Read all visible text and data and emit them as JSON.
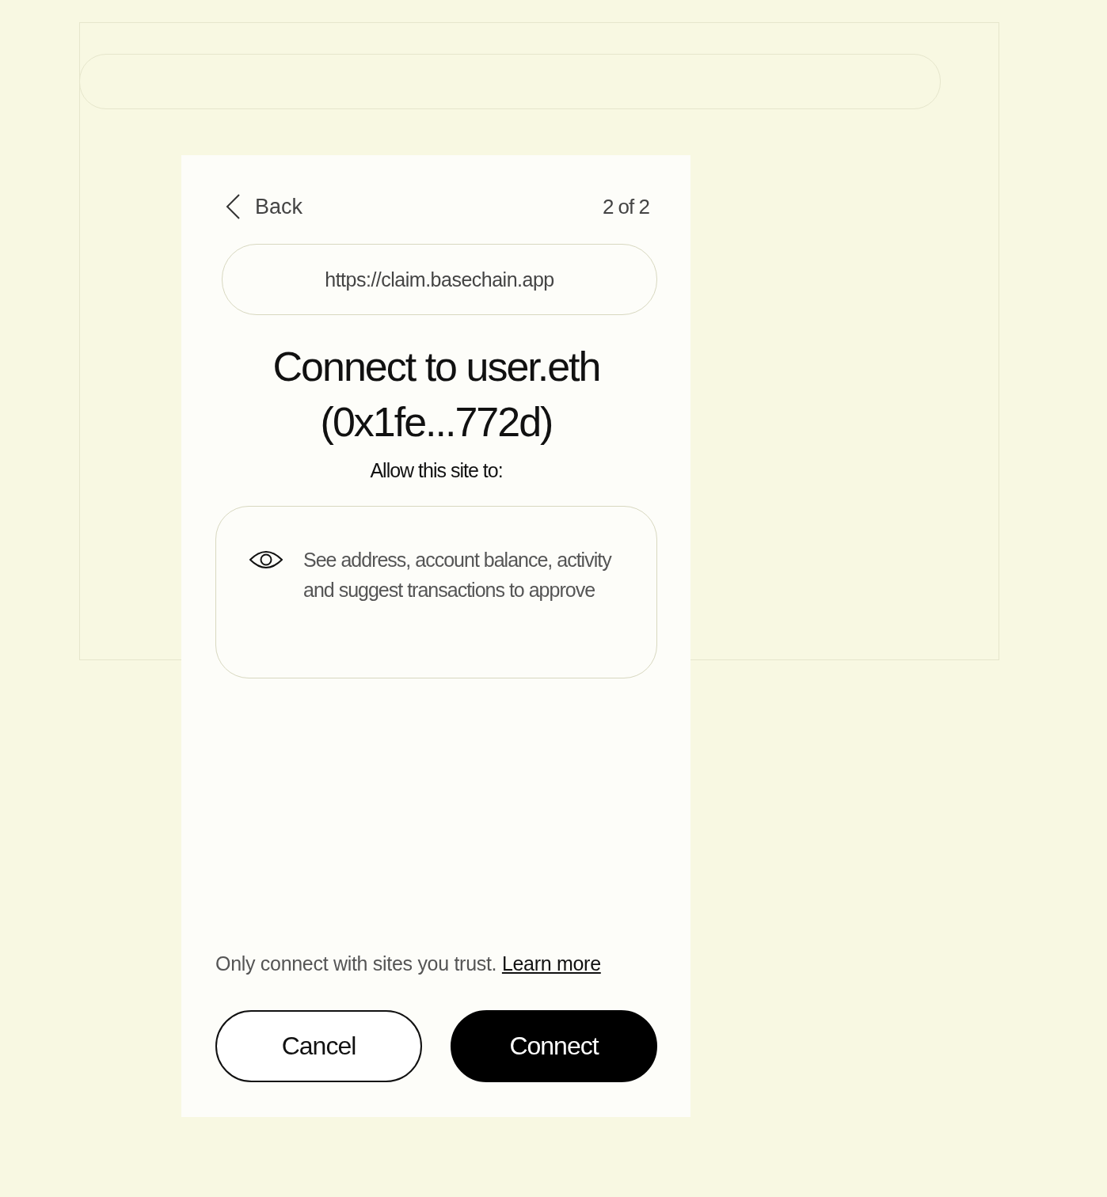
{
  "dialog": {
    "back_label": "Back",
    "step": "2 of 2",
    "site_url": "https://claim.basechain.app",
    "title": "Connect to user.eth (0x1fe...772d)",
    "subtitle": "Allow this site to:",
    "permissions": [
      {
        "kind": "view",
        "text": "See address, account balance, activity and suggest transactions to approve"
      }
    ],
    "notice": "Only connect with sites you trust.",
    "notice_link": "Learn more",
    "buttons": [
      {
        "kind": "secondary",
        "label": "Cancel"
      },
      {
        "kind": "primary",
        "label": "Connect"
      }
    ]
  }
}
